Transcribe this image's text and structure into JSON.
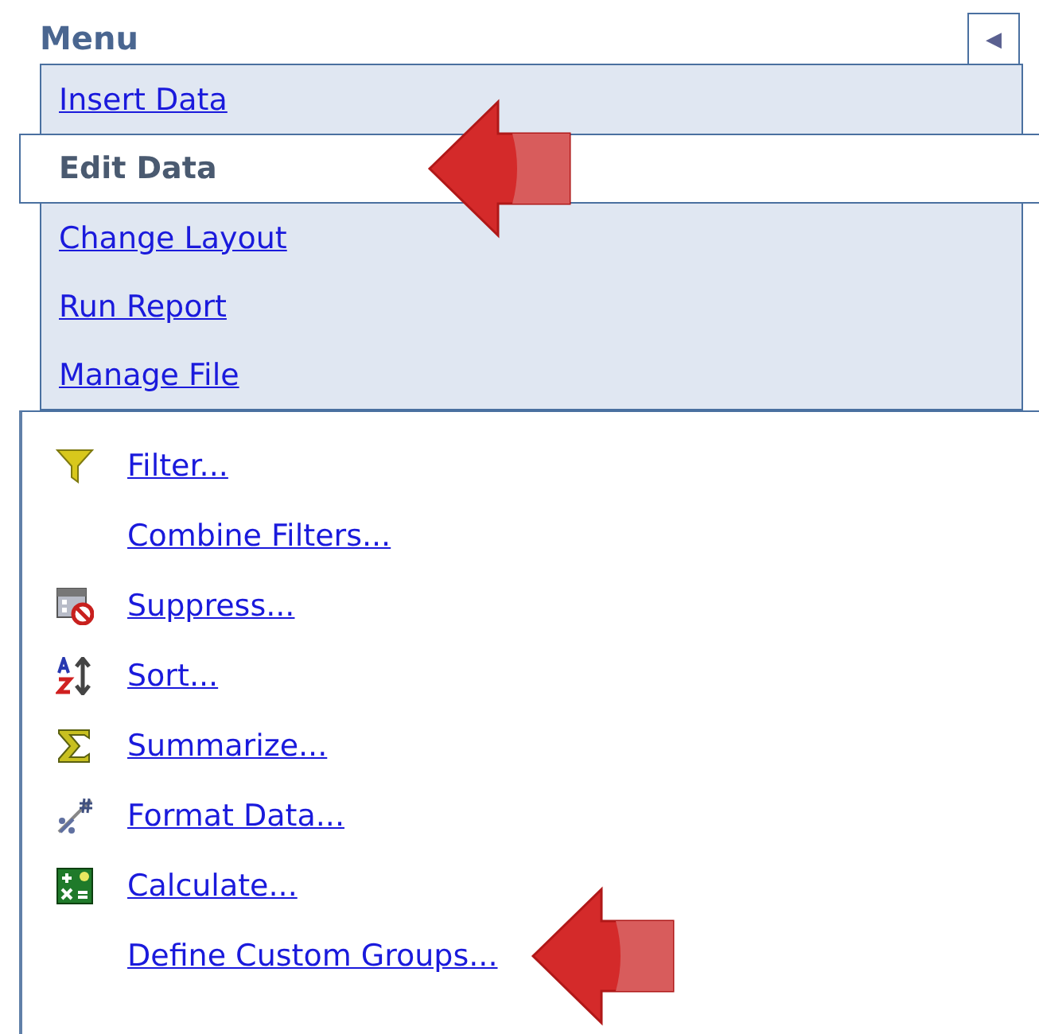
{
  "menu": {
    "title": "Menu",
    "collapse_button": "◀",
    "items": [
      {
        "label": "Insert Data",
        "selected": false,
        "pointed": false
      },
      {
        "label": "Edit Data",
        "selected": true,
        "pointed": true
      },
      {
        "label": "Change Layout",
        "selected": false,
        "pointed": false
      },
      {
        "label": "Run Report",
        "selected": false,
        "pointed": false
      },
      {
        "label": "Manage File",
        "selected": false,
        "pointed": false
      }
    ]
  },
  "actions": [
    {
      "label": "Filter...",
      "kind": "filter",
      "pointed": false
    },
    {
      "label": "Combine Filters...",
      "kind": "plain",
      "pointed": false
    },
    {
      "label": "Suppress...",
      "kind": "suppress",
      "pointed": false
    },
    {
      "label": "Sort...",
      "kind": "sort",
      "pointed": false
    },
    {
      "label": "Summarize...",
      "kind": "sum",
      "pointed": false
    },
    {
      "label": "Format Data...",
      "kind": "format",
      "pointed": false
    },
    {
      "label": "Calculate...",
      "kind": "calc",
      "pointed": false
    },
    {
      "label": "Define Custom Groups...",
      "kind": "plain",
      "pointed": true
    }
  ]
}
